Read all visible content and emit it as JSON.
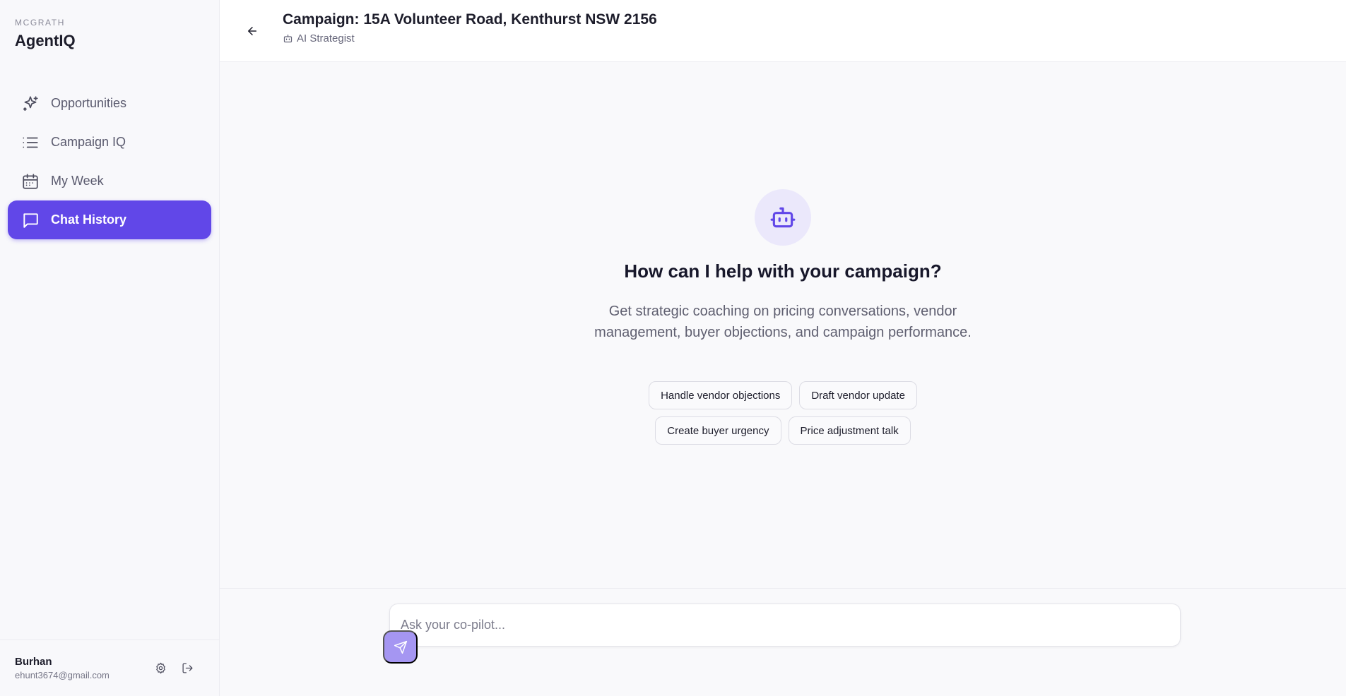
{
  "brand": {
    "sub": "MCGRATH",
    "title": "AgentIQ"
  },
  "nav": {
    "items": [
      {
        "label": "Opportunities",
        "icon": "sparkles-icon"
      },
      {
        "label": "Campaign IQ",
        "icon": "list-icon"
      },
      {
        "label": "My Week",
        "icon": "calendar-icon"
      },
      {
        "label": "Chat History",
        "icon": "chat-icon",
        "active": true
      }
    ]
  },
  "user": {
    "name": "Burhan",
    "email": "ehunt3674@gmail.com"
  },
  "header": {
    "title": "Campaign: 15A Volunteer Road, Kenthurst NSW 2156",
    "subtitle": "AI Strategist"
  },
  "empty_state": {
    "headline": "How can I help with your campaign?",
    "description": "Get strategic coaching on pricing conversations, vendor management, buyer objections, and campaign performance."
  },
  "suggestions": {
    "row1": [
      "Handle vendor objections",
      "Draft vendor update"
    ],
    "row2": [
      "Create buyer urgency",
      "Price adjustment talk"
    ]
  },
  "composer": {
    "placeholder": "Ask your co-pilot..."
  },
  "colors": {
    "accent": "#6147e8",
    "accent_light": "#ebe8fb",
    "send_button": "#a596f2"
  }
}
